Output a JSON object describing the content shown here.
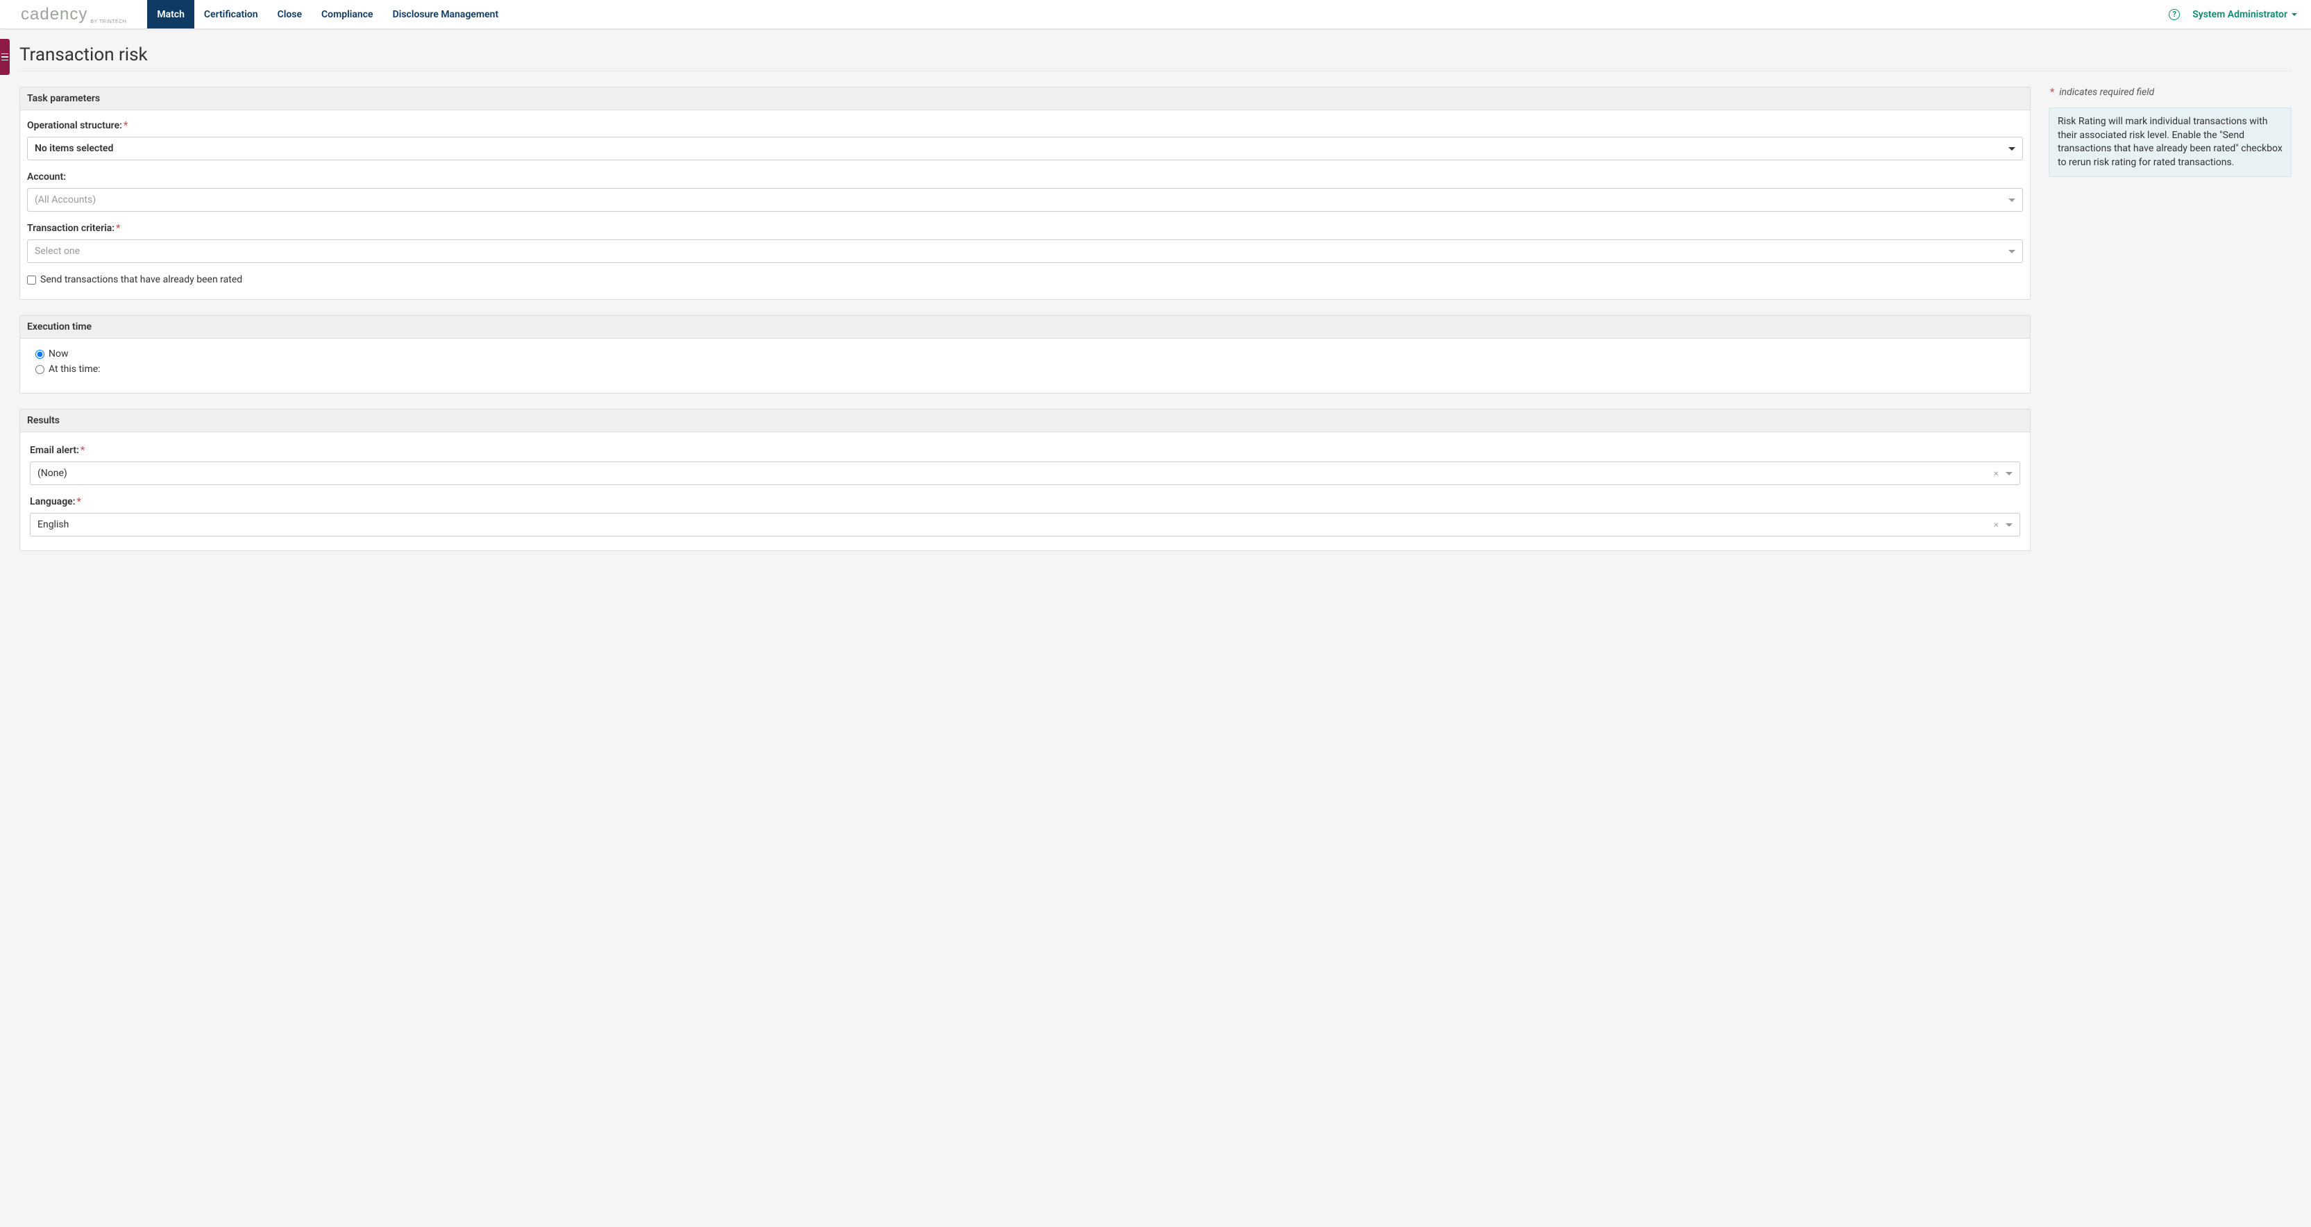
{
  "brand": {
    "name": "cadency",
    "sub": "BY TRINTECH"
  },
  "nav": {
    "tabs": [
      "Match",
      "Certification",
      "Close",
      "Compliance",
      "Disclosure Management"
    ],
    "active_index": 0,
    "user": "System Administrator"
  },
  "page": {
    "title": "Transaction risk"
  },
  "sidebar_note": {
    "required_label": "indicates required field",
    "info": "Risk Rating will mark individual transactions with their associated risk level. Enable the \"Send transactions that have already been rated\" checkbox to rerun risk rating for rated transactions."
  },
  "panels": {
    "task_parameters": {
      "title": "Task parameters",
      "op_structure": {
        "label": "Operational structure:",
        "value": "No items selected"
      },
      "account": {
        "label": "Account:",
        "placeholder": "(All Accounts)"
      },
      "criteria": {
        "label": "Transaction criteria:",
        "placeholder": "Select one"
      },
      "send_rated": {
        "label": "Send transactions that have already been rated"
      }
    },
    "execution_time": {
      "title": "Execution time",
      "now": "Now",
      "at_time": "At this time:"
    },
    "results": {
      "title": "Results",
      "email_alert": {
        "label": "Email alert:",
        "value": "(None)"
      },
      "language": {
        "label": "Language:",
        "value": "English"
      }
    }
  }
}
